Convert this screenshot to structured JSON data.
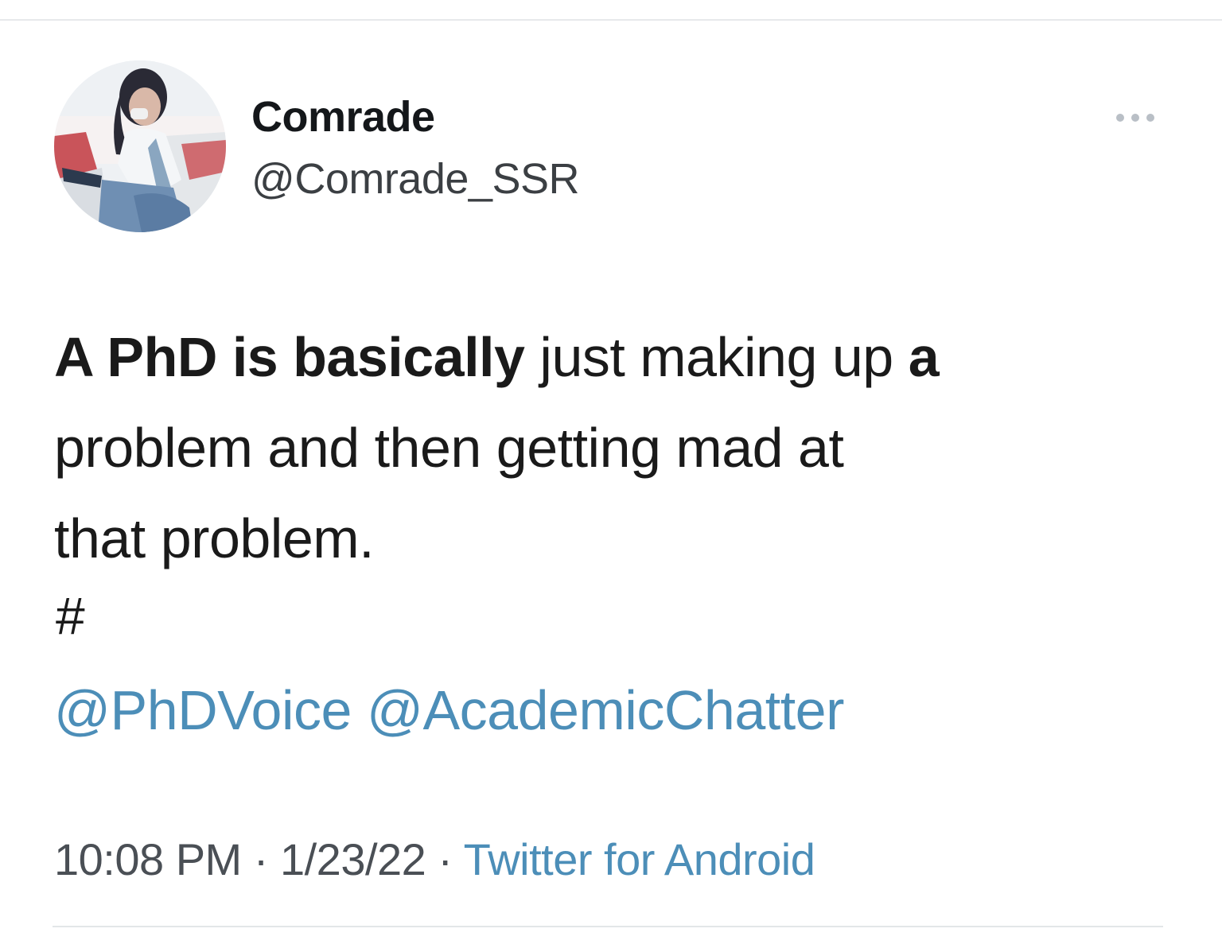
{
  "tweet": {
    "author": {
      "display_name": "Comrade",
      "handle": "@Comrade_SSR"
    },
    "menu_icon": "more-horizontal-icon",
    "text": {
      "bold_1": "A PhD is basically",
      "normal_1": " just making up ",
      "bold_2": "a",
      "normal_2": "problem and then getting mad at",
      "normal_3": "that problem.",
      "hashtag": "#"
    },
    "mentions": [
      "@PhDVoice",
      "@AcademicChatter"
    ],
    "time": "10:08 PM",
    "separator": " · ",
    "date": "1/23/22",
    "source": "Twitter for Android"
  },
  "colors": {
    "link": "#4c8eb8",
    "text": "#1a1a1a",
    "divider": "#e3e6e8"
  }
}
